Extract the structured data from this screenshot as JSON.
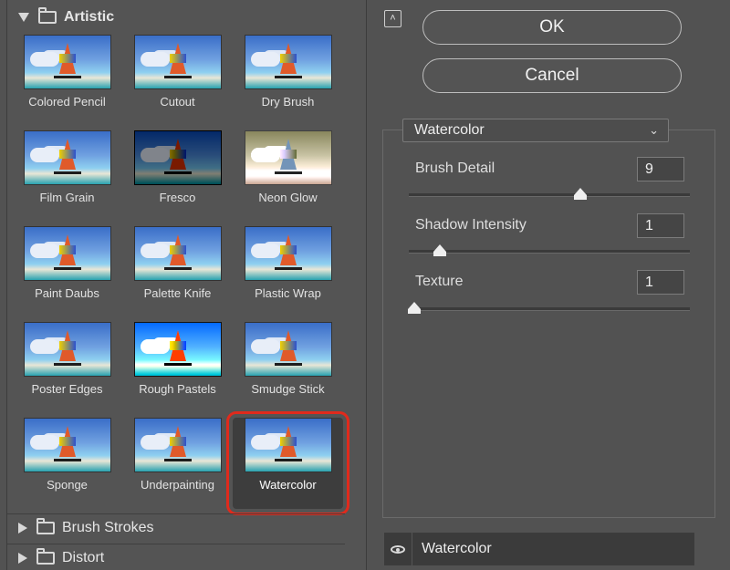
{
  "gallery": {
    "categories": [
      {
        "label": "Artistic",
        "expanded": true
      },
      {
        "label": "Brush Strokes",
        "expanded": false
      },
      {
        "label": "Distort",
        "expanded": false
      }
    ],
    "filters": [
      {
        "label": "Colored Pencil"
      },
      {
        "label": "Cutout"
      },
      {
        "label": "Dry Brush"
      },
      {
        "label": "Film Grain"
      },
      {
        "label": "Fresco"
      },
      {
        "label": "Neon Glow"
      },
      {
        "label": "Paint Daubs"
      },
      {
        "label": "Palette Knife"
      },
      {
        "label": "Plastic Wrap"
      },
      {
        "label": "Poster Edges"
      },
      {
        "label": "Rough Pastels"
      },
      {
        "label": "Smudge Stick"
      },
      {
        "label": "Sponge"
      },
      {
        "label": "Underpainting"
      },
      {
        "label": "Watercolor",
        "selected": true
      }
    ],
    "selection_color": "#e02a1c"
  },
  "actions": {
    "ok_label": "OK",
    "cancel_label": "Cancel",
    "collapse_icon": "double-chevron-up-icon"
  },
  "settings": {
    "filter": "Watercolor",
    "params": [
      {
        "label": "Brush Detail",
        "value": "9",
        "slider_fraction": 0.61
      },
      {
        "label": "Shadow Intensity",
        "value": "1",
        "slider_fraction": 0.11
      },
      {
        "label": "Texture",
        "value": "1",
        "slider_fraction": 0.02
      }
    ]
  },
  "layers": {
    "items": [
      {
        "label": "Watercolor",
        "visible": true
      }
    ]
  }
}
